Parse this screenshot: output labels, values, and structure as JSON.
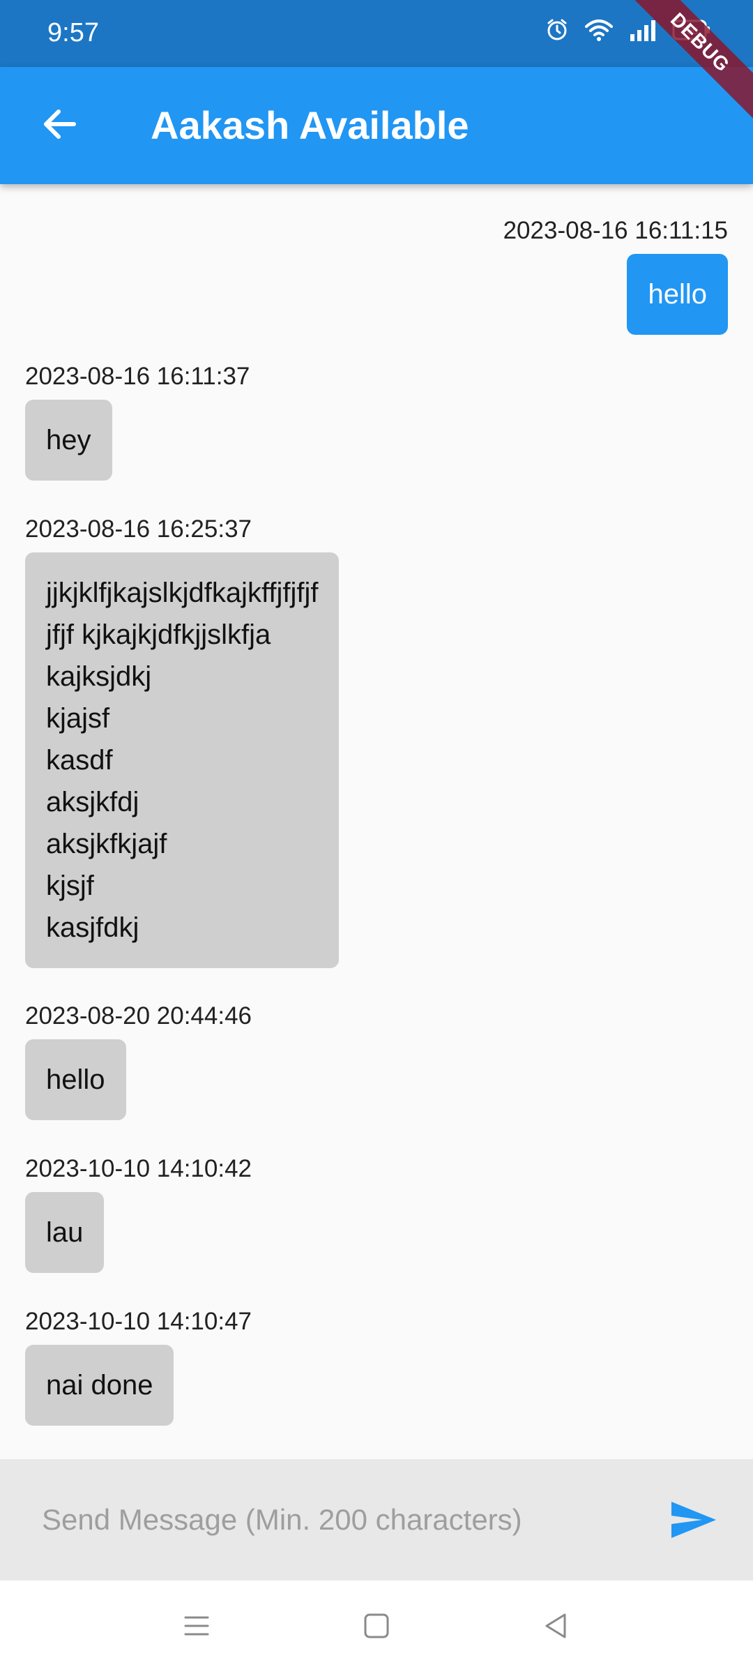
{
  "status_bar": {
    "time": "9:57",
    "battery": "100"
  },
  "debug_banner": {
    "label": "DEBUG"
  },
  "app_bar": {
    "title": "Aakash Available",
    "back_icon": "arrow-left-icon"
  },
  "messages": [
    {
      "direction": "outgoing",
      "timestamp": "2023-08-16 16:11:15",
      "text": "hello"
    },
    {
      "direction": "incoming",
      "timestamp": "2023-08-16 16:11:37",
      "text": "hey"
    },
    {
      "direction": "incoming",
      "timestamp": "2023-08-16 16:25:37",
      "text": "jjkjklfjkajslkjdfkajkffjfjfjf\njfjf kjkajkjdfkjjslkfja\nkajksjdkj\nkjajsf\nkasdf\naksjkfdj\naksjkfkjajf\nkjsjf\nkasjfdkj"
    },
    {
      "direction": "incoming",
      "timestamp": "2023-08-20 20:44:46",
      "text": "hello"
    },
    {
      "direction": "incoming",
      "timestamp": "2023-10-10 14:10:42",
      "text": "lau"
    },
    {
      "direction": "incoming",
      "timestamp": "2023-10-10 14:10:47",
      "text": "nai done"
    }
  ],
  "composer": {
    "placeholder": "Send Message (Min. 200 characters)",
    "value": "",
    "send_icon": "send-icon"
  },
  "colors": {
    "status_bar": "#1c76c4",
    "app_bar": "#2196f3",
    "outgoing_bubble": "#2196f3",
    "incoming_bubble": "#cfcfcf",
    "background": "#fafafa",
    "composer": "#e8e8e8"
  }
}
